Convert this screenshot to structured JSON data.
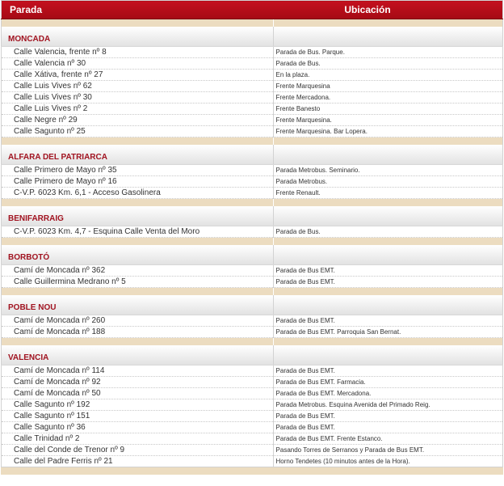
{
  "header": {
    "parada": "Parada",
    "ubicacion": "Ubicación"
  },
  "groups": [
    {
      "name": "MONCADA",
      "stops": [
        {
          "parada": "Calle Valencia, frente nº 8",
          "ubicacion": "Parada de Bus. Parque."
        },
        {
          "parada": "Calle Valencia nº 30",
          "ubicacion": "Parada de Bus."
        },
        {
          "parada": "Calle Xátiva, frente nº 27",
          "ubicacion": "En la plaza."
        },
        {
          "parada": "Calle Luis Vives nº 62",
          "ubicacion": "Frente Marquesina"
        },
        {
          "parada": "Calle Luis Vives nº 30",
          "ubicacion": "Frente Mercadona."
        },
        {
          "parada": "Calle Luis Vives nº 2",
          "ubicacion": "Frente Banesto"
        },
        {
          "parada": "Calle Negre nº 29",
          "ubicacion": "Frente Marquesina."
        },
        {
          "parada": "Calle Sagunto nº 25",
          "ubicacion": "Frente Marquesina. Bar Lopera."
        }
      ]
    },
    {
      "name": "ALFARA DEL PATRIARCA",
      "stops": [
        {
          "parada": "Calle Primero de Mayo nº 35",
          "ubicacion": "Parada Metrobus. Seminario."
        },
        {
          "parada": "Calle Primero de Mayo nº 16",
          "ubicacion": "Parada Metrobus."
        },
        {
          "parada": "C-V.P. 6023 Km. 6,1 - Acceso Gasolinera",
          "ubicacion": "Frente Renault."
        }
      ]
    },
    {
      "name": "BENIFARRAIG",
      "stops": [
        {
          "parada": "C-V.P. 6023 Km. 4,7 - Esquina Calle Venta del Moro",
          "ubicacion": "Parada de Bus."
        }
      ]
    },
    {
      "name": "BORBOTÓ",
      "stops": [
        {
          "parada": "Camí de Moncada nº 362",
          "ubicacion": "Parada de Bus EMT."
        },
        {
          "parada": "Calle Guillermina Medrano nº 5",
          "ubicacion": "Parada de Bus EMT."
        }
      ]
    },
    {
      "name": "POBLE NOU",
      "stops": [
        {
          "parada": "Camí de Moncada nº 260",
          "ubicacion": "Parada de Bus EMT."
        },
        {
          "parada": "Camí de Moncada nº 188",
          "ubicacion": "Parada de Bus EMT. Parroquia San Bernat."
        }
      ]
    },
    {
      "name": "VALENCIA",
      "stops": [
        {
          "parada": "Camí de Moncada nº 114",
          "ubicacion": "Parada de Bus EMT."
        },
        {
          "parada": "Camí de Moncada nº 92",
          "ubicacion": "Parada de Bus EMT. Farmacia."
        },
        {
          "parada": "Camí de Moncada nº 50",
          "ubicacion": "Parada de Bus EMT. Mercadona."
        },
        {
          "parada": "Calle Sagunto nº 192",
          "ubicacion": "Parada Metrobus. Esquina Avenida del Primado Reig."
        },
        {
          "parada": "Calle Sagunto nº 151",
          "ubicacion": "Parada de Bus EMT."
        },
        {
          "parada": "Calle Sagunto nº 36",
          "ubicacion": "Parada de Bus EMT."
        },
        {
          "parada": "Calle Trinidad nº 2",
          "ubicacion": "Parada de Bus EMT. Frente Estanco."
        },
        {
          "parada": "Calle del Conde de Trenor nº 9",
          "ubicacion": "Pasando Torres de Serranos y Parada de Bus EMT."
        },
        {
          "parada": "Calle del Padre Ferris nº 21",
          "ubicacion": "Horno Tendetes (10 minutos antes de la Hora)."
        }
      ]
    }
  ]
}
